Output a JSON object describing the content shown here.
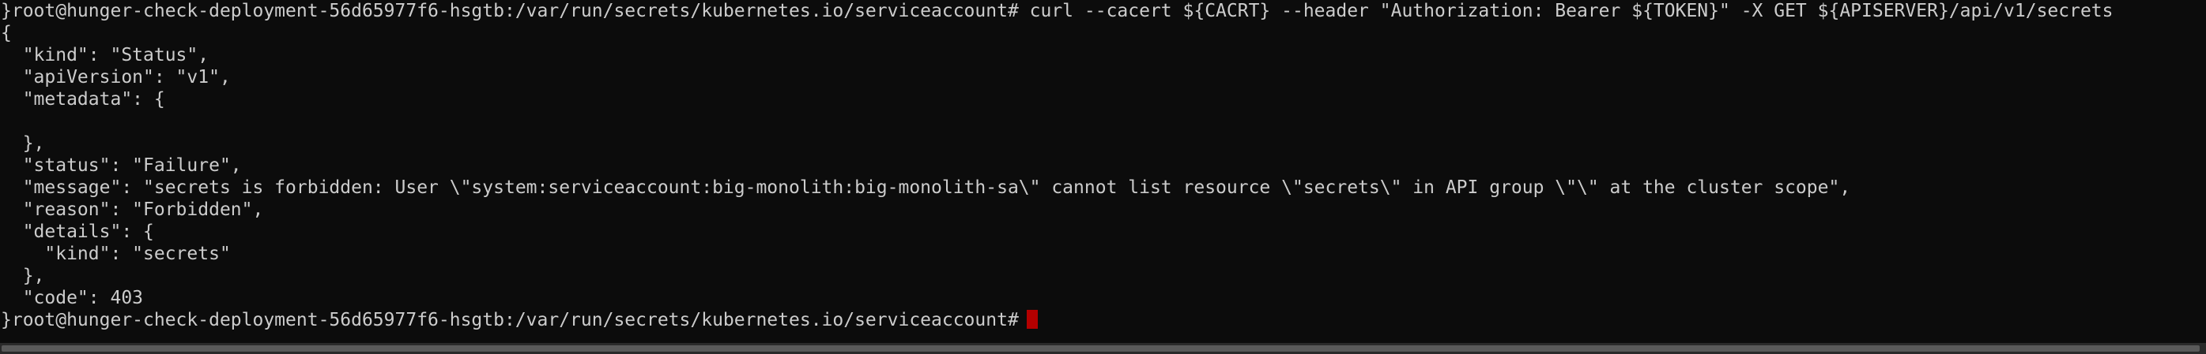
{
  "terminal": {
    "lines": [
      "}root@hunger-check-deployment-56d65977f6-hsgtb:/var/run/secrets/kubernetes.io/serviceaccount# curl --cacert ${CACRT} --header \"Authorization: Bearer ${TOKEN}\" -X GET ${APISERVER}/api/v1/secrets",
      "{",
      "  \"kind\": \"Status\",",
      "  \"apiVersion\": \"v1\",",
      "  \"metadata\": {",
      "",
      "  },",
      "  \"status\": \"Failure\",",
      "  \"message\": \"secrets is forbidden: User \\\"system:serviceaccount:big-monolith:big-monolith-sa\\\" cannot list resource \\\"secrets\\\" in API group \\\"\\\" at the cluster scope\",",
      "  \"reason\": \"Forbidden\",",
      "  \"details\": {",
      "    \"kind\": \"secrets\"",
      "  },",
      "  \"code\": 403"
    ],
    "prompt": "}root@hunger-check-deployment-56d65977f6-hsgtb:/var/run/secrets/kubernetes.io/serviceaccount#",
    "cursor_color": "#b40000"
  }
}
